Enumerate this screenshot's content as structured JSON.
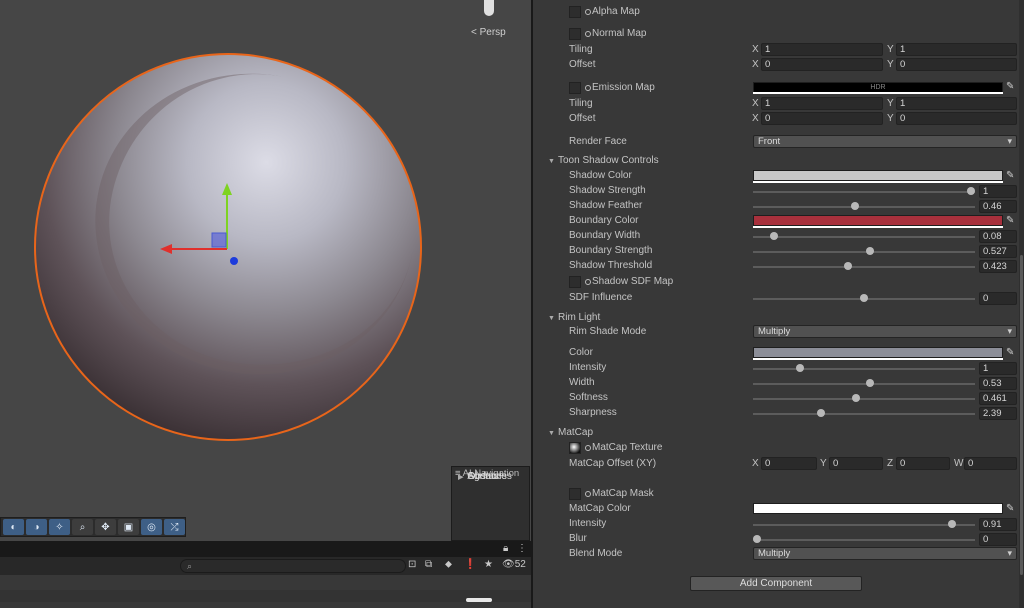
{
  "scene": {
    "view_label": "Persp",
    "ai_navigation": {
      "title": "AI Navigation",
      "items": [
        "Surfaces",
        "Agents",
        "Obstacles"
      ]
    }
  },
  "hierarchy": {
    "search_placeholder": "",
    "visible_count": "52"
  },
  "inspector": {
    "alpha_map": "Alpha Map",
    "normal_map": "Normal Map",
    "tiling_label": "Tiling",
    "offset_label": "Offset",
    "normal_tiling": {
      "x": "1",
      "y": "1"
    },
    "normal_offset": {
      "x": "0",
      "y": "0"
    },
    "emission_map": "Emission Map",
    "emission_hdr": "HDR",
    "emission_tiling": {
      "x": "1",
      "y": "1"
    },
    "emission_offset": {
      "x": "0",
      "y": "0"
    },
    "render_face": {
      "label": "Render Face",
      "value": "Front"
    },
    "toon_shadow": {
      "title": "Toon Shadow Controls",
      "shadow_color": "Shadow Color",
      "shadow_strength": {
        "label": "Shadow Strength",
        "value": "1",
        "fraction": 1.0
      },
      "shadow_feather": {
        "label": "Shadow Feather",
        "value": "0.46",
        "fraction": 0.46
      },
      "boundary_color": "Boundary Color",
      "boundary_width": {
        "label": "Boundary Width",
        "value": "0.08",
        "fraction": 0.08
      },
      "boundary_strength": {
        "label": "Boundary Strength",
        "value": "0.527",
        "fraction": 0.527
      },
      "shadow_threshold": {
        "label": "Shadow Threshold",
        "value": "0.423",
        "fraction": 0.423
      },
      "shadow_sdf_map": "Shadow SDF Map",
      "sdf_influence": {
        "label": "SDF Influence",
        "value": "0",
        "fraction": 0.5
      }
    },
    "rim_light": {
      "title": "Rim Light",
      "mode": {
        "label": "Rim Shade Mode",
        "value": "Multiply"
      },
      "color": "Color",
      "intensity": {
        "label": "Intensity",
        "value": "1",
        "fraction": 0.2
      },
      "width": {
        "label": "Width",
        "value": "0.53",
        "fraction": 0.53
      },
      "softness": {
        "label": "Softness",
        "value": "0.461",
        "fraction": 0.461
      },
      "sharpness": {
        "label": "Sharpness",
        "value": "2.39",
        "fraction": 0.3
      }
    },
    "matcap": {
      "title": "MatCap",
      "texture": "MatCap Texture",
      "offset_label": "MatCap Offset (XY)",
      "offset": {
        "x": "0",
        "y": "0",
        "z": "0",
        "w": "0"
      },
      "mask": "MatCap Mask",
      "color": "MatCap Color",
      "intensity": {
        "label": "Intensity",
        "value": "0.91",
        "fraction": 0.91
      },
      "blur": {
        "label": "Blur",
        "value": "0",
        "fraction": 0.0
      },
      "blend_mode": {
        "label": "Blend Mode",
        "value": "Multiply"
      }
    },
    "add_component": "Add Component"
  },
  "colors": {
    "selection_outline": "#e8651a",
    "shadow_color": "#c8c8c8",
    "boundary_color": "#a8303c",
    "rim_color": "#8c8e98",
    "matcap_color": "#ffffff",
    "emission_color": "#000000"
  }
}
